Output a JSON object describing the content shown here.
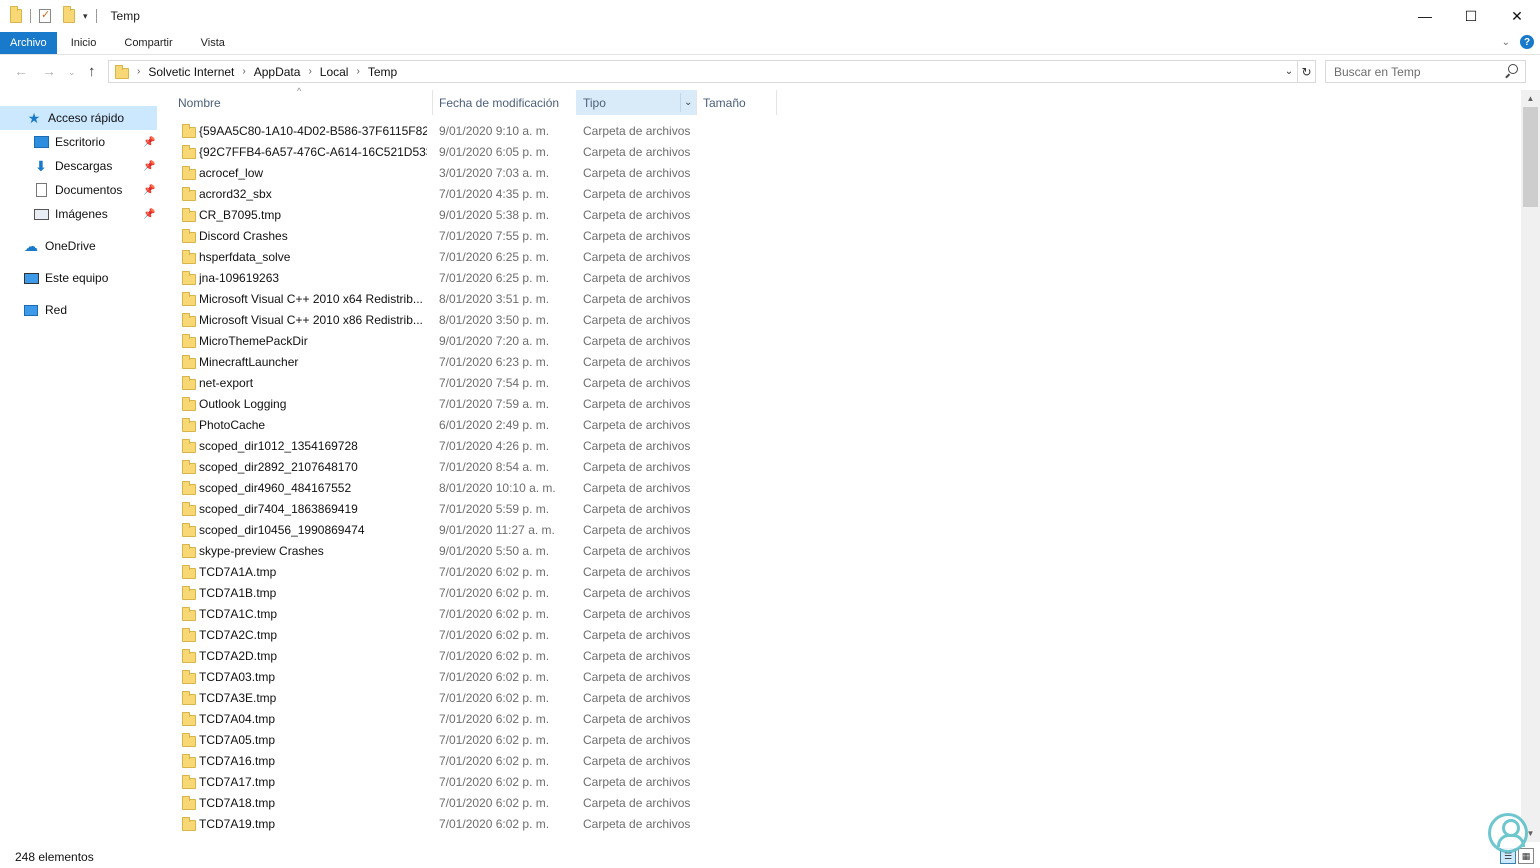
{
  "window": {
    "title": "Temp",
    "controls": {
      "minimize": "—",
      "maximize": "☐",
      "close": "✕"
    }
  },
  "ribbon": {
    "tabs": [
      "Archivo",
      "Inicio",
      "Compartir",
      "Vista"
    ]
  },
  "address": {
    "crumbs": [
      "Solvetic Internet",
      "AppData",
      "Local",
      "Temp"
    ]
  },
  "search": {
    "placeholder": "Buscar en Temp"
  },
  "sidebar": {
    "items": [
      {
        "label": "Acceso rápido",
        "icon": "star-icon",
        "selected": true
      },
      {
        "label": "Escritorio",
        "icon": "desktop-icon",
        "pinned": true
      },
      {
        "label": "Descargas",
        "icon": "download-arrow-icon",
        "pinned": true
      },
      {
        "label": "Documentos",
        "icon": "document-icon",
        "pinned": true
      },
      {
        "label": "Imágenes",
        "icon": "pictures-icon",
        "pinned": true
      },
      {
        "label": "OneDrive",
        "icon": "cloud-icon"
      },
      {
        "label": "Este equipo",
        "icon": "computer-icon"
      },
      {
        "label": "Red",
        "icon": "network-icon"
      }
    ]
  },
  "columns": {
    "name": "Nombre",
    "date": "Fecha de modificación",
    "type": "Tipo",
    "size": "Tamaño"
  },
  "rows": [
    {
      "name": "{59AA5C80-1A10-4D02-B586-37F6115F82...",
      "date": "9/01/2020 9:10 a. m.",
      "type": "Carpeta de archivos",
      "size": ""
    },
    {
      "name": "{92C7FFB4-6A57-476C-A614-16C521D533...",
      "date": "9/01/2020 6:05 p. m.",
      "type": "Carpeta de archivos",
      "size": ""
    },
    {
      "name": "acrocef_low",
      "date": "3/01/2020 7:03 a. m.",
      "type": "Carpeta de archivos",
      "size": ""
    },
    {
      "name": "acrord32_sbx",
      "date": "7/01/2020 4:35 p. m.",
      "type": "Carpeta de archivos",
      "size": ""
    },
    {
      "name": "CR_B7095.tmp",
      "date": "9/01/2020 5:38 p. m.",
      "type": "Carpeta de archivos",
      "size": ""
    },
    {
      "name": "Discord Crashes",
      "date": "7/01/2020 7:55 p. m.",
      "type": "Carpeta de archivos",
      "size": ""
    },
    {
      "name": "hsperfdata_solve",
      "date": "7/01/2020 6:25 p. m.",
      "type": "Carpeta de archivos",
      "size": ""
    },
    {
      "name": "jna-109619263",
      "date": "7/01/2020 6:25 p. m.",
      "type": "Carpeta de archivos",
      "size": ""
    },
    {
      "name": "Microsoft Visual C++ 2010  x64 Redistrib...",
      "date": "8/01/2020 3:51 p. m.",
      "type": "Carpeta de archivos",
      "size": ""
    },
    {
      "name": "Microsoft Visual C++ 2010  x86 Redistrib...",
      "date": "8/01/2020 3:50 p. m.",
      "type": "Carpeta de archivos",
      "size": ""
    },
    {
      "name": "MicroThemePackDir",
      "date": "9/01/2020 7:20 a. m.",
      "type": "Carpeta de archivos",
      "size": ""
    },
    {
      "name": "MinecraftLauncher",
      "date": "7/01/2020 6:23 p. m.",
      "type": "Carpeta de archivos",
      "size": ""
    },
    {
      "name": "net-export",
      "date": "7/01/2020 7:54 p. m.",
      "type": "Carpeta de archivos",
      "size": ""
    },
    {
      "name": "Outlook Logging",
      "date": "7/01/2020 7:59 a. m.",
      "type": "Carpeta de archivos",
      "size": ""
    },
    {
      "name": "PhotoCache",
      "date": "6/01/2020 2:49 p. m.",
      "type": "Carpeta de archivos",
      "size": ""
    },
    {
      "name": "scoped_dir1012_1354169728",
      "date": "7/01/2020 4:26 p. m.",
      "type": "Carpeta de archivos",
      "size": ""
    },
    {
      "name": "scoped_dir2892_2107648170",
      "date": "7/01/2020 8:54 a. m.",
      "type": "Carpeta de archivos",
      "size": ""
    },
    {
      "name": "scoped_dir4960_484167552",
      "date": "8/01/2020 10:10 a. m.",
      "type": "Carpeta de archivos",
      "size": ""
    },
    {
      "name": "scoped_dir7404_1863869419",
      "date": "7/01/2020 5:59 p. m.",
      "type": "Carpeta de archivos",
      "size": ""
    },
    {
      "name": "scoped_dir10456_1990869474",
      "date": "9/01/2020 11:27 a. m.",
      "type": "Carpeta de archivos",
      "size": ""
    },
    {
      "name": "skype-preview Crashes",
      "date": "9/01/2020 5:50 a. m.",
      "type": "Carpeta de archivos",
      "size": ""
    },
    {
      "name": "TCD7A1A.tmp",
      "date": "7/01/2020 6:02 p. m.",
      "type": "Carpeta de archivos",
      "size": ""
    },
    {
      "name": "TCD7A1B.tmp",
      "date": "7/01/2020 6:02 p. m.",
      "type": "Carpeta de archivos",
      "size": ""
    },
    {
      "name": "TCD7A1C.tmp",
      "date": "7/01/2020 6:02 p. m.",
      "type": "Carpeta de archivos",
      "size": ""
    },
    {
      "name": "TCD7A2C.tmp",
      "date": "7/01/2020 6:02 p. m.",
      "type": "Carpeta de archivos",
      "size": ""
    },
    {
      "name": "TCD7A2D.tmp",
      "date": "7/01/2020 6:02 p. m.",
      "type": "Carpeta de archivos",
      "size": ""
    },
    {
      "name": "TCD7A03.tmp",
      "date": "7/01/2020 6:02 p. m.",
      "type": "Carpeta de archivos",
      "size": ""
    },
    {
      "name": "TCD7A3E.tmp",
      "date": "7/01/2020 6:02 p. m.",
      "type": "Carpeta de archivos",
      "size": ""
    },
    {
      "name": "TCD7A04.tmp",
      "date": "7/01/2020 6:02 p. m.",
      "type": "Carpeta de archivos",
      "size": ""
    },
    {
      "name": "TCD7A05.tmp",
      "date": "7/01/2020 6:02 p. m.",
      "type": "Carpeta de archivos",
      "size": ""
    },
    {
      "name": "TCD7A16.tmp",
      "date": "7/01/2020 6:02 p. m.",
      "type": "Carpeta de archivos",
      "size": ""
    },
    {
      "name": "TCD7A17.tmp",
      "date": "7/01/2020 6:02 p. m.",
      "type": "Carpeta de archivos",
      "size": ""
    },
    {
      "name": "TCD7A18.tmp",
      "date": "7/01/2020 6:02 p. m.",
      "type": "Carpeta de archivos",
      "size": ""
    },
    {
      "name": "TCD7A19.tmp",
      "date": "7/01/2020 6:02 p. m.",
      "type": "Carpeta de archivos",
      "size": ""
    }
  ],
  "status": {
    "count": "248 elementos"
  },
  "colors": {
    "accent": "#1979ca",
    "selected": "#cce8ff",
    "folder": "#f8d775"
  }
}
